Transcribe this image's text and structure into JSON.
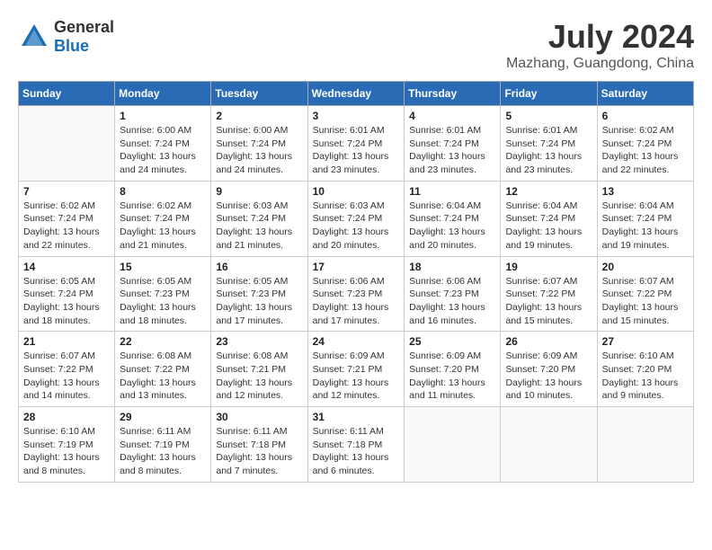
{
  "header": {
    "logo_general": "General",
    "logo_blue": "Blue",
    "month_title": "July 2024",
    "location": "Mazhang, Guangdong, China"
  },
  "days_of_week": [
    "Sunday",
    "Monday",
    "Tuesday",
    "Wednesday",
    "Thursday",
    "Friday",
    "Saturday"
  ],
  "weeks": [
    [
      {
        "day": "",
        "info": ""
      },
      {
        "day": "1",
        "info": "Sunrise: 6:00 AM\nSunset: 7:24 PM\nDaylight: 13 hours\nand 24 minutes."
      },
      {
        "day": "2",
        "info": "Sunrise: 6:00 AM\nSunset: 7:24 PM\nDaylight: 13 hours\nand 24 minutes."
      },
      {
        "day": "3",
        "info": "Sunrise: 6:01 AM\nSunset: 7:24 PM\nDaylight: 13 hours\nand 23 minutes."
      },
      {
        "day": "4",
        "info": "Sunrise: 6:01 AM\nSunset: 7:24 PM\nDaylight: 13 hours\nand 23 minutes."
      },
      {
        "day": "5",
        "info": "Sunrise: 6:01 AM\nSunset: 7:24 PM\nDaylight: 13 hours\nand 23 minutes."
      },
      {
        "day": "6",
        "info": "Sunrise: 6:02 AM\nSunset: 7:24 PM\nDaylight: 13 hours\nand 22 minutes."
      }
    ],
    [
      {
        "day": "7",
        "info": "Sunrise: 6:02 AM\nSunset: 7:24 PM\nDaylight: 13 hours\nand 22 minutes."
      },
      {
        "day": "8",
        "info": "Sunrise: 6:02 AM\nSunset: 7:24 PM\nDaylight: 13 hours\nand 21 minutes."
      },
      {
        "day": "9",
        "info": "Sunrise: 6:03 AM\nSunset: 7:24 PM\nDaylight: 13 hours\nand 21 minutes."
      },
      {
        "day": "10",
        "info": "Sunrise: 6:03 AM\nSunset: 7:24 PM\nDaylight: 13 hours\nand 20 minutes."
      },
      {
        "day": "11",
        "info": "Sunrise: 6:04 AM\nSunset: 7:24 PM\nDaylight: 13 hours\nand 20 minutes."
      },
      {
        "day": "12",
        "info": "Sunrise: 6:04 AM\nSunset: 7:24 PM\nDaylight: 13 hours\nand 19 minutes."
      },
      {
        "day": "13",
        "info": "Sunrise: 6:04 AM\nSunset: 7:24 PM\nDaylight: 13 hours\nand 19 minutes."
      }
    ],
    [
      {
        "day": "14",
        "info": "Sunrise: 6:05 AM\nSunset: 7:24 PM\nDaylight: 13 hours\nand 18 minutes."
      },
      {
        "day": "15",
        "info": "Sunrise: 6:05 AM\nSunset: 7:23 PM\nDaylight: 13 hours\nand 18 minutes."
      },
      {
        "day": "16",
        "info": "Sunrise: 6:05 AM\nSunset: 7:23 PM\nDaylight: 13 hours\nand 17 minutes."
      },
      {
        "day": "17",
        "info": "Sunrise: 6:06 AM\nSunset: 7:23 PM\nDaylight: 13 hours\nand 17 minutes."
      },
      {
        "day": "18",
        "info": "Sunrise: 6:06 AM\nSunset: 7:23 PM\nDaylight: 13 hours\nand 16 minutes."
      },
      {
        "day": "19",
        "info": "Sunrise: 6:07 AM\nSunset: 7:22 PM\nDaylight: 13 hours\nand 15 minutes."
      },
      {
        "day": "20",
        "info": "Sunrise: 6:07 AM\nSunset: 7:22 PM\nDaylight: 13 hours\nand 15 minutes."
      }
    ],
    [
      {
        "day": "21",
        "info": "Sunrise: 6:07 AM\nSunset: 7:22 PM\nDaylight: 13 hours\nand 14 minutes."
      },
      {
        "day": "22",
        "info": "Sunrise: 6:08 AM\nSunset: 7:22 PM\nDaylight: 13 hours\nand 13 minutes."
      },
      {
        "day": "23",
        "info": "Sunrise: 6:08 AM\nSunset: 7:21 PM\nDaylight: 13 hours\nand 12 minutes."
      },
      {
        "day": "24",
        "info": "Sunrise: 6:09 AM\nSunset: 7:21 PM\nDaylight: 13 hours\nand 12 minutes."
      },
      {
        "day": "25",
        "info": "Sunrise: 6:09 AM\nSunset: 7:20 PM\nDaylight: 13 hours\nand 11 minutes."
      },
      {
        "day": "26",
        "info": "Sunrise: 6:09 AM\nSunset: 7:20 PM\nDaylight: 13 hours\nand 10 minutes."
      },
      {
        "day": "27",
        "info": "Sunrise: 6:10 AM\nSunset: 7:20 PM\nDaylight: 13 hours\nand 9 minutes."
      }
    ],
    [
      {
        "day": "28",
        "info": "Sunrise: 6:10 AM\nSunset: 7:19 PM\nDaylight: 13 hours\nand 8 minutes."
      },
      {
        "day": "29",
        "info": "Sunrise: 6:11 AM\nSunset: 7:19 PM\nDaylight: 13 hours\nand 8 minutes."
      },
      {
        "day": "30",
        "info": "Sunrise: 6:11 AM\nSunset: 7:18 PM\nDaylight: 13 hours\nand 7 minutes."
      },
      {
        "day": "31",
        "info": "Sunrise: 6:11 AM\nSunset: 7:18 PM\nDaylight: 13 hours\nand 6 minutes."
      },
      {
        "day": "",
        "info": ""
      },
      {
        "day": "",
        "info": ""
      },
      {
        "day": "",
        "info": ""
      }
    ]
  ]
}
